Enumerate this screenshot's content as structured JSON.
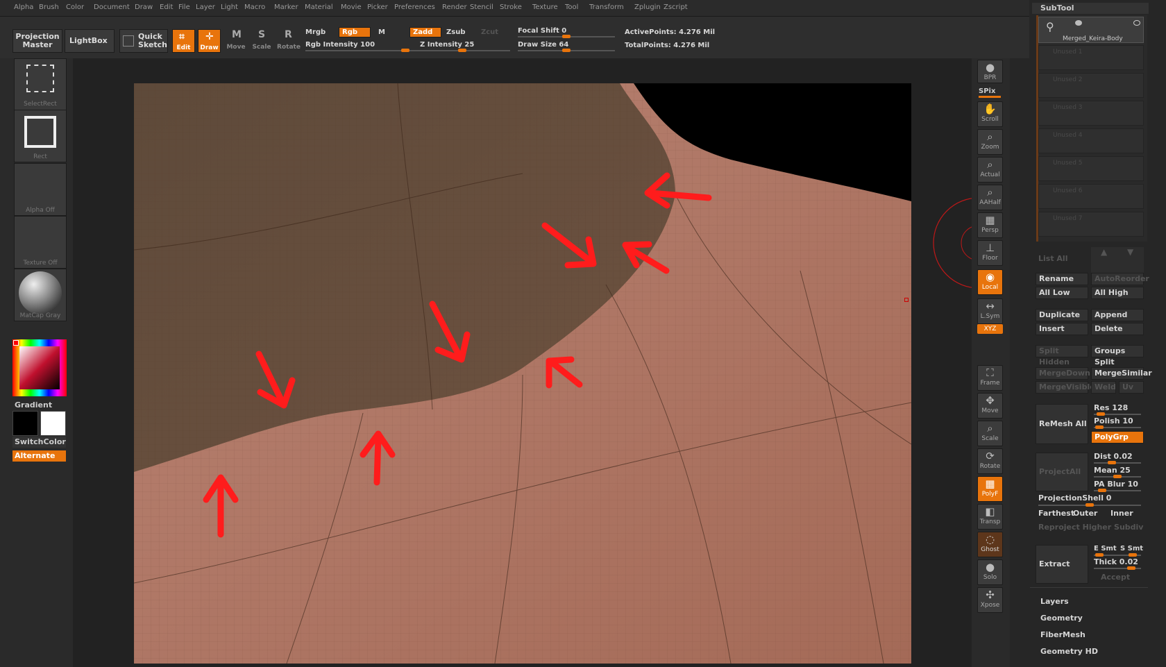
{
  "menu": [
    "Alpha",
    "Brush",
    "Color",
    "Document",
    "Draw",
    "Edit",
    "File",
    "Layer",
    "Light",
    "Macro",
    "Marker",
    "Material",
    "Movie",
    "Picker",
    "Preferences",
    "Render",
    "Stencil",
    "Stroke",
    "Texture",
    "Tool",
    "Transform",
    "Zplugin",
    "Zscript"
  ],
  "toolbar": {
    "projection_master": "Projection Master",
    "lightbox": "LightBox",
    "quick_sketch": "Quick Sketch",
    "edit": "Edit",
    "draw": "Draw",
    "move": "Move",
    "scale": "Scale",
    "rotate": "Rotate",
    "mrgb": "Mrgb",
    "rgb": "Rgb",
    "m": "M",
    "rgb_intensity": "Rgb Intensity 100",
    "zadd": "Zadd",
    "zsub": "Zsub",
    "zcut": "Zcut",
    "z_intensity": "Z Intensity 25",
    "focal_shift": "Focal Shift 0",
    "draw_size": "Draw Size 64",
    "active_points": "ActivePoints: 4.276 Mil",
    "total_points": "TotalPoints: 4.276 Mil"
  },
  "left_shelf": {
    "select_rect": "SelectRect",
    "rect": "Rect",
    "alpha_off": "Alpha Off",
    "texture_off": "Texture Off",
    "matcap": "MatCap Gray",
    "gradient": "Gradient",
    "switch_color": "SwitchColor",
    "alternate": "Alternate"
  },
  "right_shelf": [
    {
      "label": "BPR",
      "icon": "sphere-icon"
    },
    {
      "label": "Scroll",
      "icon": "hand-icon"
    },
    {
      "label": "Zoom",
      "icon": "zoom-icon"
    },
    {
      "label": "Actual",
      "icon": "zoom-icon"
    },
    {
      "label": "AAHalf",
      "icon": "zoom-icon"
    },
    {
      "label": "Persp",
      "icon": "grid-icon"
    },
    {
      "label": "Floor",
      "icon": "floor-icon"
    },
    {
      "label": "Local",
      "icon": "local-icon"
    },
    {
      "label": "L.Sym",
      "icon": "sym-icon"
    },
    {
      "label": "Frame",
      "icon": "frame-icon"
    },
    {
      "label": "Move",
      "icon": "move-icon"
    },
    {
      "label": "Scale",
      "icon": "scale-icon"
    },
    {
      "label": "Rotate",
      "icon": "rotate-icon"
    },
    {
      "label": "PolyF",
      "icon": "polyframe-icon"
    },
    {
      "label": "Transp",
      "icon": "transp-icon"
    },
    {
      "label": "Ghost",
      "icon": "ghost-icon"
    },
    {
      "label": "Solo",
      "icon": "solo-icon"
    },
    {
      "label": "Xpose",
      "icon": "xpose-icon"
    }
  ],
  "spix": "SPix",
  "xyz": "XYZ",
  "subtool": {
    "title": "SubTool",
    "active": "Merged_Keira-Body",
    "unused": [
      "Unused 1",
      "Unused 2",
      "Unused 3",
      "Unused 4",
      "Unused 5",
      "Unused 6",
      "Unused 7"
    ],
    "list_all": "List All",
    "rename": "Rename",
    "auto_reorder": "AutoReorder",
    "all_low": "All Low",
    "all_high": "All High",
    "duplicate": "Duplicate",
    "append": "Append",
    "insert": "Insert",
    "delete": "Delete",
    "split_hidden": "Split Hidden",
    "groups_split": "Groups Split",
    "merge_down": "MergeDown",
    "merge_similar": "MergeSimilar",
    "merge_visible": "MergeVisible",
    "weld": "Weld",
    "uv": "Uv",
    "remesh_all": "ReMesh All",
    "res": "Res 128",
    "polish": "Polish 10",
    "polygrp": "PolyGrp",
    "project_all": "ProjectAll",
    "dist": "Dist 0.02",
    "mean": "Mean 25",
    "pa_blur": "PA Blur 10",
    "projection_shell": "ProjectionShell 0",
    "farthest": "Farthest",
    "outer": "Outer",
    "inner": "Inner",
    "reproject": "Reproject Higher Subdiv",
    "extract": "Extract",
    "e_smt": "E Smt",
    "s_smt": "S Smt",
    "thick": "Thick 0.02",
    "accept": "Accept"
  },
  "panels": [
    "Layers",
    "Geometry",
    "FiberMesh",
    "Geometry HD"
  ],
  "colors": {
    "accent": "#e8740c",
    "skin": "#b07361",
    "arrow": "#ff1c1c"
  }
}
